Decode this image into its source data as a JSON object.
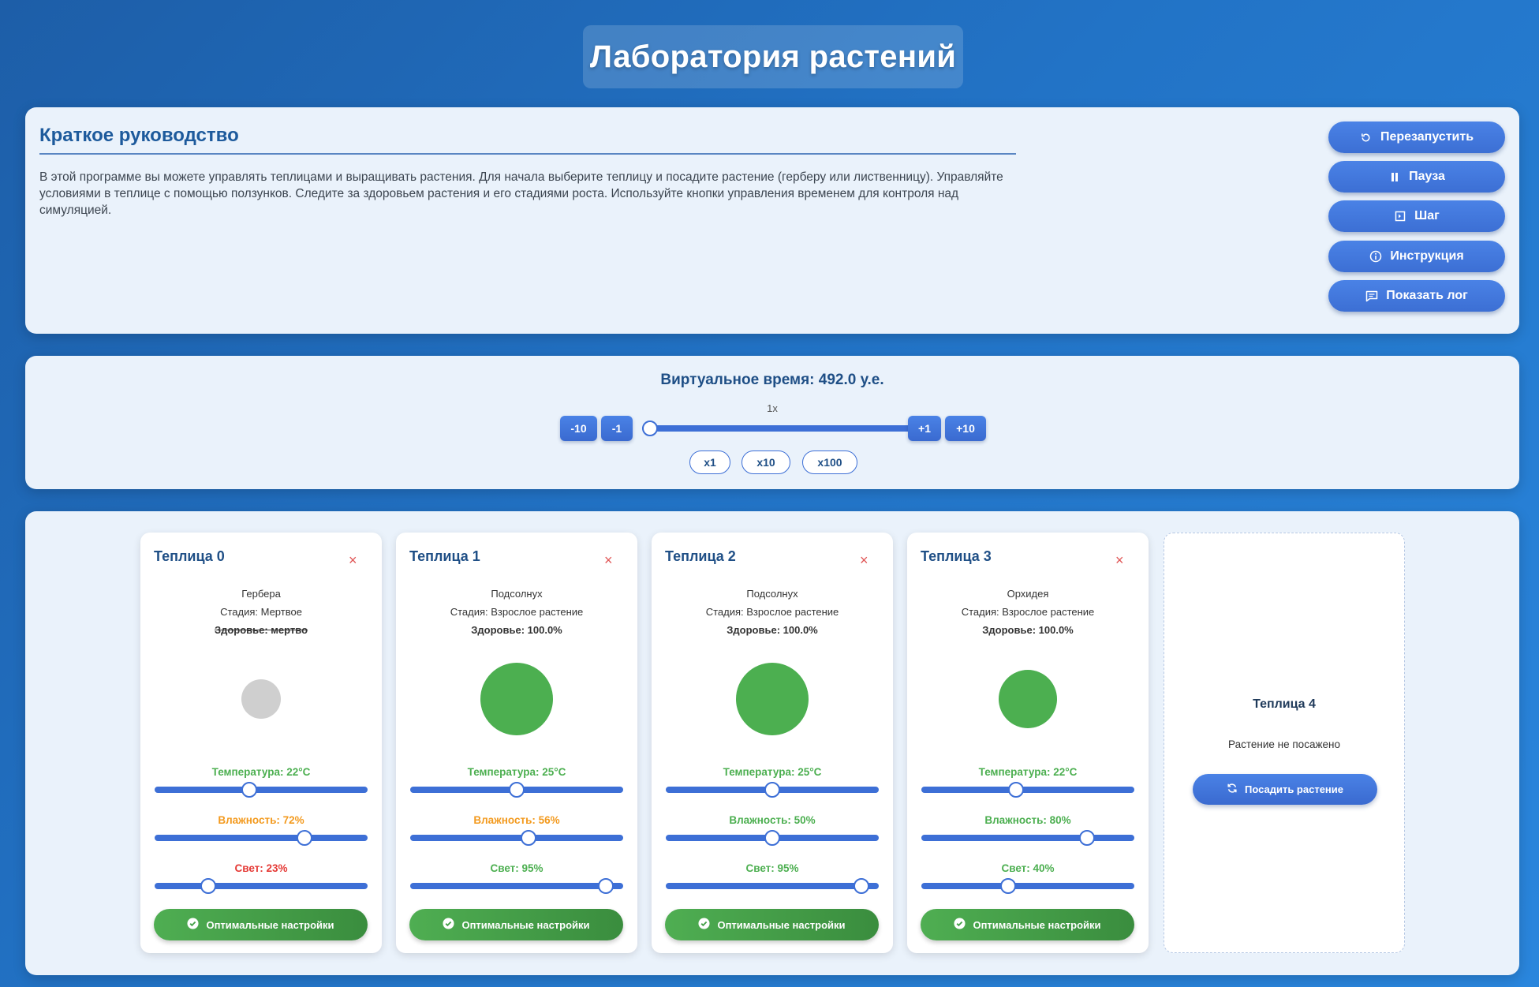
{
  "app": {
    "title": "Лаборатория растений"
  },
  "guide": {
    "heading": "Краткое руководство",
    "text": "В этой программе вы можете управлять теплицами и выращивать растения. Для начала выберите теплицу и посадите растение (герберу или лиственницу). Управляйте условиями в теплице с помощью ползунков. Следите за здоровьем растения и его стадиями роста. Используйте кнопки управления временем для контроля над симуляцией.",
    "buttons": [
      {
        "label": "Перезапустить",
        "icon": "restart-icon"
      },
      {
        "label": "Пауза",
        "icon": "pause-icon"
      },
      {
        "label": "Шаг",
        "icon": "step-icon"
      },
      {
        "label": "Инструкция",
        "icon": "info-icon"
      },
      {
        "label": "Показать лог",
        "icon": "log-icon"
      }
    ]
  },
  "time": {
    "label": "Виртуальное время: 492.0 у.е.",
    "speed": "1x",
    "speed_slider_fraction": 0.0,
    "back_buttons": [
      "-10",
      "-1"
    ],
    "forward_buttons": [
      "+1",
      "+10"
    ],
    "multipliers": [
      "x1",
      "x10",
      "x100"
    ]
  },
  "greenhouses": [
    {
      "title": "Теплица 0",
      "close": "×",
      "plant": "Гербера",
      "stage": "Стадия: Мертвое",
      "health": "Здоровье: мертво",
      "health_status": "dead",
      "plant_color": "#cfcfcf",
      "plant_size": "small",
      "temperature": {
        "label": "Температура: 22°C",
        "fraction": 0.44,
        "status": "green"
      },
      "humidity": {
        "label": "Влажность: 72%",
        "fraction": 0.72,
        "status": "orange"
      },
      "light": {
        "label": "Свет: 23%",
        "fraction": 0.23,
        "status": "red"
      },
      "optimal_button": "Оптимальные настройки"
    },
    {
      "title": "Теплица 1",
      "close": "×",
      "plant": "Подсолнух",
      "stage": "Стадия: Взрослое растение",
      "health": "Здоровье: 100.0%",
      "health_status": "green",
      "plant_color": "#4caf50",
      "plant_size": "large",
      "temperature": {
        "label": "Температура: 25°C",
        "fraction": 0.5,
        "status": "green"
      },
      "humidity": {
        "label": "Влажность: 56%",
        "fraction": 0.56,
        "status": "orange"
      },
      "light": {
        "label": "Свет: 95%",
        "fraction": 0.95,
        "status": "green"
      },
      "optimal_button": "Оптимальные настройки"
    },
    {
      "title": "Теплица 2",
      "close": "×",
      "plant": "Подсолнух",
      "stage": "Стадия: Взрослое растение",
      "health": "Здоровье: 100.0%",
      "health_status": "green",
      "plant_color": "#4caf50",
      "plant_size": "large",
      "temperature": {
        "label": "Температура: 25°C",
        "fraction": 0.5,
        "status": "green"
      },
      "humidity": {
        "label": "Влажность: 50%",
        "fraction": 0.5,
        "status": "green"
      },
      "light": {
        "label": "Свет: 95%",
        "fraction": 0.95,
        "status": "green"
      },
      "optimal_button": "Оптимальные настройки"
    },
    {
      "title": "Теплица 3",
      "close": "×",
      "plant": "Орхидея",
      "stage": "Стадия: Взрослое растение",
      "health": "Здоровье: 100.0%",
      "health_status": "green",
      "plant_color": "#4caf50",
      "plant_size": "medium",
      "temperature": {
        "label": "Температура: 22°C",
        "fraction": 0.44,
        "status": "green"
      },
      "humidity": {
        "label": "Влажность: 80%",
        "fraction": 0.8,
        "status": "green"
      },
      "light": {
        "label": "Свет: 40%",
        "fraction": 0.4,
        "status": "green"
      },
      "optimal_button": "Оптимальные настройки"
    }
  ],
  "empty_greenhouse": {
    "title": "Теплица 4",
    "note": "Растение не посажено",
    "button": "Посадить растение"
  },
  "colors": {
    "accent": "#3d6fd6",
    "ok": "#4caf50",
    "warn": "#f39a1e",
    "bad": "#e53935"
  }
}
